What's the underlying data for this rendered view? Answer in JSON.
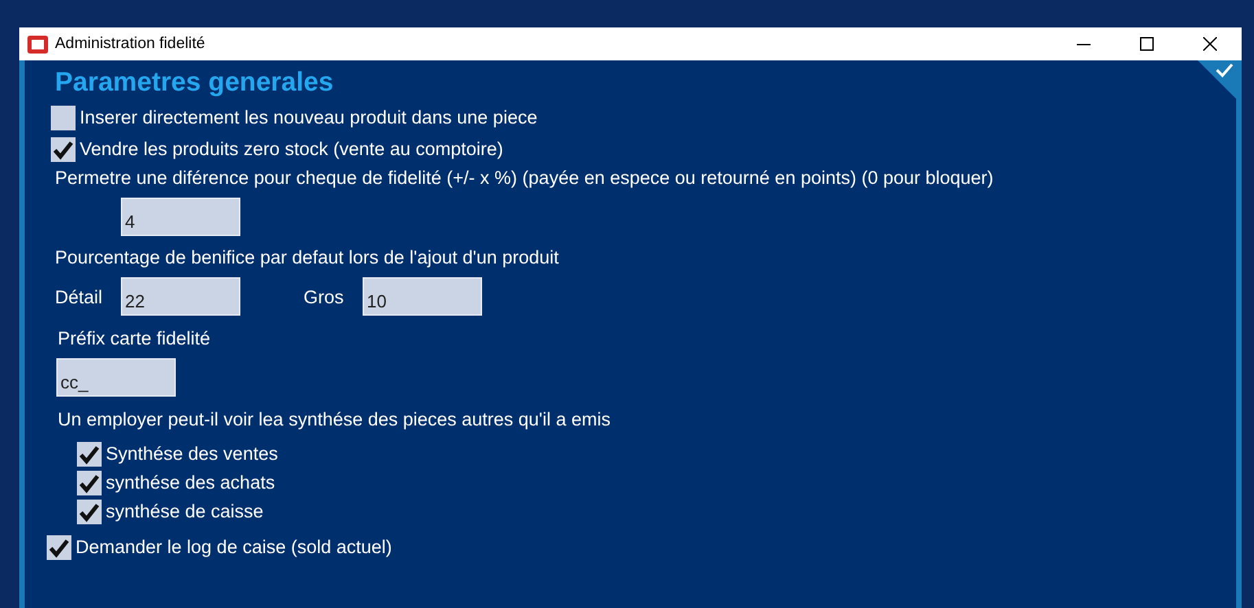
{
  "window": {
    "title": "Administration fidelité"
  },
  "heading": "Parametres generales",
  "items": [
    {
      "kind": "checkbox",
      "label": "Inserer directement les nouveau produit dans une piece",
      "checked": false
    },
    {
      "kind": "checkbox",
      "label": "Vendre les produits zero stock (vente au comptoire)",
      "checked": true
    },
    {
      "kind": "label",
      "text": "Permetre une diférence pour cheque de fidelité (+/- x %) (payée en espece ou retourné en points) (0 pour bloquer)"
    },
    {
      "kind": "fieldrow",
      "fields": [
        {
          "value": "4"
        }
      ]
    },
    {
      "kind": "label",
      "text": "Pourcentage de benifice par defaut lors de l'ajout d'un produit"
    },
    {
      "kind": "fieldrow",
      "fields": [
        {
          "label": "Détail",
          "value": "22"
        },
        {
          "label": "Gros",
          "value": "10"
        }
      ]
    },
    {
      "kind": "label",
      "text": "Préfix carte fidelité"
    },
    {
      "kind": "field",
      "value": "cc_"
    },
    {
      "kind": "label",
      "text": "Un employer peut-il voir lea synthése des pieces autres qu'il a emis",
      "children": [
        {
          "kind": "checkbox",
          "label": "Synthése des ventes",
          "checked": true
        },
        {
          "kind": "checkbox",
          "label": "synthése des achats",
          "checked": true
        },
        {
          "kind": "checkbox",
          "label": "synthése de caisse",
          "checked": true
        }
      ]
    },
    {
      "kind": "checkbox",
      "label": "Demander le log de caise (sold actuel)",
      "checked": true
    }
  ]
}
